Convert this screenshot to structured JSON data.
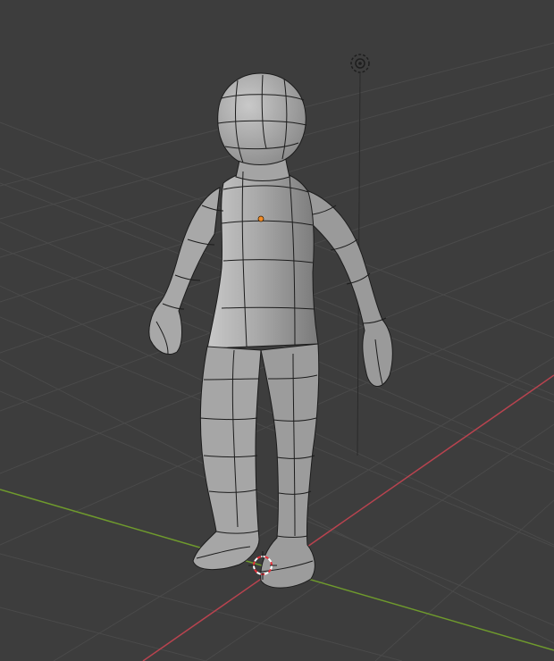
{
  "viewport": {
    "view": "perspective",
    "shading": "solid",
    "wireframe_overlay": true,
    "colors": {
      "background": "#3d3d3d",
      "grid_line": "#4a4a4a",
      "x_axis": "#b8434f",
      "y_axis": "#6f9a2d",
      "mesh_fill": "#9e9e9e",
      "mesh_wire": "#1c1c1c",
      "origin_dot": "#f28c28",
      "cursor_red": "#e8303a",
      "cursor_white": "#ffffff"
    }
  },
  "objects": [
    {
      "name_icon": "character-mesh",
      "type": "mesh",
      "selected": false
    },
    {
      "name_icon": "light-icon",
      "type": "light"
    },
    {
      "name_icon": "3d-cursor-icon",
      "type": "cursor"
    }
  ]
}
